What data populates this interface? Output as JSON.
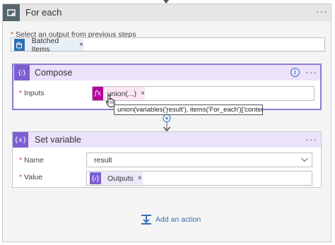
{
  "foreach": {
    "title": "For each",
    "more_label": "···",
    "select_required_mark": "*",
    "select_label": "Select an output from previous steps",
    "token_label": "Batched Items",
    "token_remove": "×"
  },
  "compose": {
    "title": "Compose",
    "info_glyph": "i",
    "more_label": "···",
    "inputs_required_mark": "*",
    "inputs_label": "Inputs",
    "fx_glyph": "fx",
    "token_label": "union(...)",
    "token_remove": "×",
    "tooltip": "union(variables('result'), items('For_each')['content'])",
    "icon_glyph": "{⁄}"
  },
  "set_variable": {
    "title": "Set variable",
    "icon_glyph": "{x}",
    "more_label": "···",
    "name_required_mark": "*",
    "name_label": "Name",
    "name_value": "result",
    "value_required_mark": "*",
    "value_label": "Value",
    "value_token_label": "Outputs",
    "value_token_remove": "×"
  },
  "add_action": {
    "label": "Add an action"
  },
  "colors": {
    "compose_accent": "#8f79d3",
    "header_purple": "#ebe2fb",
    "icon_purple": "#7c5fd1",
    "fx_magenta": "#b4009e",
    "link_blue": "#2f6fb3",
    "foreach_icon": "#56666f"
  }
}
